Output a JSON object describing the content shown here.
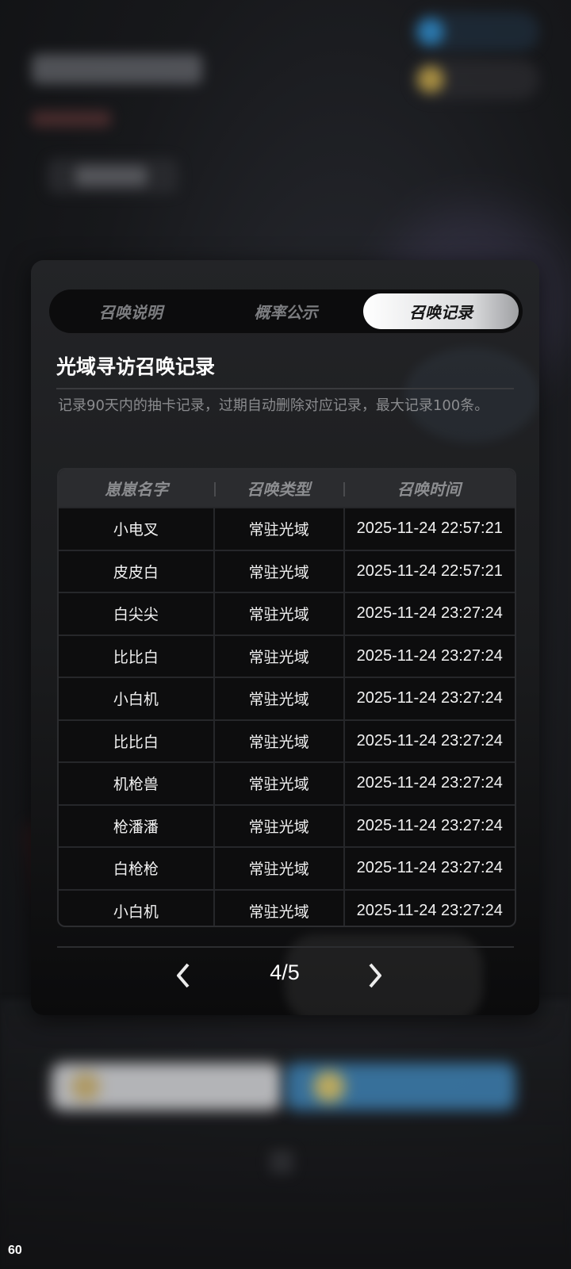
{
  "status": {
    "fps": "60"
  },
  "tabs": [
    {
      "label": "召唤说明",
      "active": false
    },
    {
      "label": "概率公示",
      "active": false
    },
    {
      "label": "召唤记录",
      "active": true
    }
  ],
  "record": {
    "title": "光域寻访召唤记录",
    "description": "记录90天内的抽卡记录，过期自动删除对应记录，最大记录100条。"
  },
  "table": {
    "headers": [
      "崽崽名字",
      "召唤类型",
      "召唤时间"
    ],
    "rows": [
      {
        "name": "小电叉",
        "type": "常驻光域",
        "time": "2025-11-24 22:57:21"
      },
      {
        "name": "皮皮白",
        "type": "常驻光域",
        "time": "2025-11-24 22:57:21"
      },
      {
        "name": "白尖尖",
        "type": "常驻光域",
        "time": "2025-11-24 23:27:24"
      },
      {
        "name": "比比白",
        "type": "常驻光域",
        "time": "2025-11-24 23:27:24"
      },
      {
        "name": "小白机",
        "type": "常驻光域",
        "time": "2025-11-24 23:27:24"
      },
      {
        "name": "比比白",
        "type": "常驻光域",
        "time": "2025-11-24 23:27:24"
      },
      {
        "name": "机枪兽",
        "type": "常驻光域",
        "time": "2025-11-24 23:27:24"
      },
      {
        "name": "枪潘潘",
        "type": "常驻光域",
        "time": "2025-11-24 23:27:24"
      },
      {
        "name": "白枪枪",
        "type": "常驻光域",
        "time": "2025-11-24 23:27:24"
      },
      {
        "name": "小白机",
        "type": "常驻光域",
        "time": "2025-11-24 23:27:24"
      }
    ]
  },
  "pagination": {
    "label": "4/5",
    "prev_icon": "chevron-left-icon",
    "next_icon": "chevron-right-icon"
  },
  "colors": {
    "panel": "#1b1c1e",
    "active_tab": "#ffffff",
    "muted_text": "#8a8b8e"
  }
}
